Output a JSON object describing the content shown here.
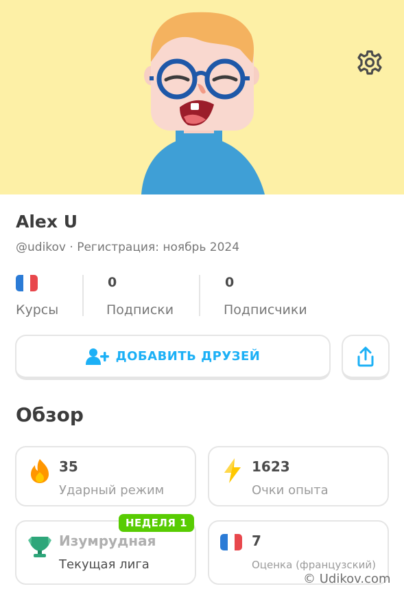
{
  "profile": {
    "name": "Alex U",
    "subtitle": "@udikov · Регистрация: ноябрь 2024",
    "banner_color": "#fdf0a6"
  },
  "stats": {
    "courses_label": "Курсы",
    "following_value": "0",
    "following_label": "Подписки",
    "followers_value": "0",
    "followers_label": "Подписчики"
  },
  "actions": {
    "add_friends_label": "ДОБАВИТЬ ДРУЗЕЙ",
    "add_friends_icon": "add-user-icon",
    "share_icon": "share-icon",
    "settings_icon": "gear-icon",
    "accent_color": "#1cb0f6"
  },
  "overview": {
    "title": "Обзор",
    "streak": {
      "value": "35",
      "label": "Ударный режим",
      "icon": "fire-icon"
    },
    "xp": {
      "value": "1623",
      "label": "Очки опыта",
      "icon": "lightning-icon"
    },
    "league": {
      "value": "Изумрудная",
      "label": "Текущая лига",
      "badge": "НЕДЕЛЯ 1",
      "icon": "emerald-trophy-icon"
    },
    "score": {
      "value": "7",
      "label": "Оценка (французский)",
      "icon": "french-flag-icon"
    }
  },
  "watermark": "© Udikov.com"
}
